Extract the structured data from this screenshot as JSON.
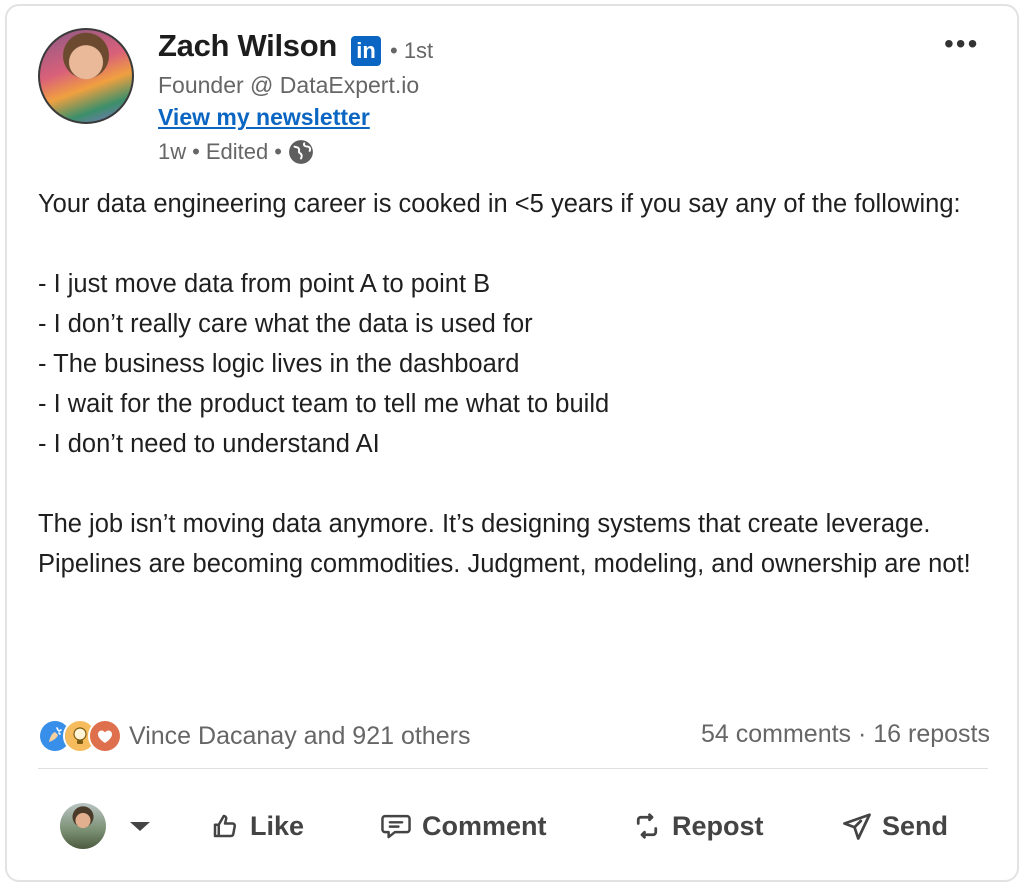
{
  "author": {
    "name": "Zach Wilson",
    "linkedin_badge": "in",
    "degree": "• 1st",
    "headline": "Founder @ DataExpert.io",
    "newsletter_link": "View my newsletter",
    "meta_time": "1w",
    "meta_sep1": "•",
    "meta_edited": "Edited",
    "meta_sep2": "•"
  },
  "menu_label": "•••",
  "post": {
    "text": "Your data engineering career is cooked in <5 years if you say any of the following:\n\n- I just move data from point A to point B\n- I don’t really care what the data is used for\n- The business logic lives in the dashboard\n- I wait for the product team to tell me what to build\n- I don’t need to understand AI\n\nThe job isn’t moving data anymore. It’s designing systems that create leverage.\nPipelines are becoming commodities. Judgment, modeling, and ownership are not!"
  },
  "social": {
    "reactions_text": "Vince Dacanay and 921 others",
    "counts_text": "54 comments · 16 reposts",
    "reaction_icons": [
      "celebrate-icon",
      "insightful-icon",
      "love-icon"
    ]
  },
  "actions": {
    "like": "Like",
    "comment": "Comment",
    "repost": "Repost",
    "send": "Send"
  },
  "colors": {
    "accent": "#0a66c2",
    "celebrate": "#378fe9",
    "insightful": "#f5bb5c",
    "love": "#df704d"
  }
}
